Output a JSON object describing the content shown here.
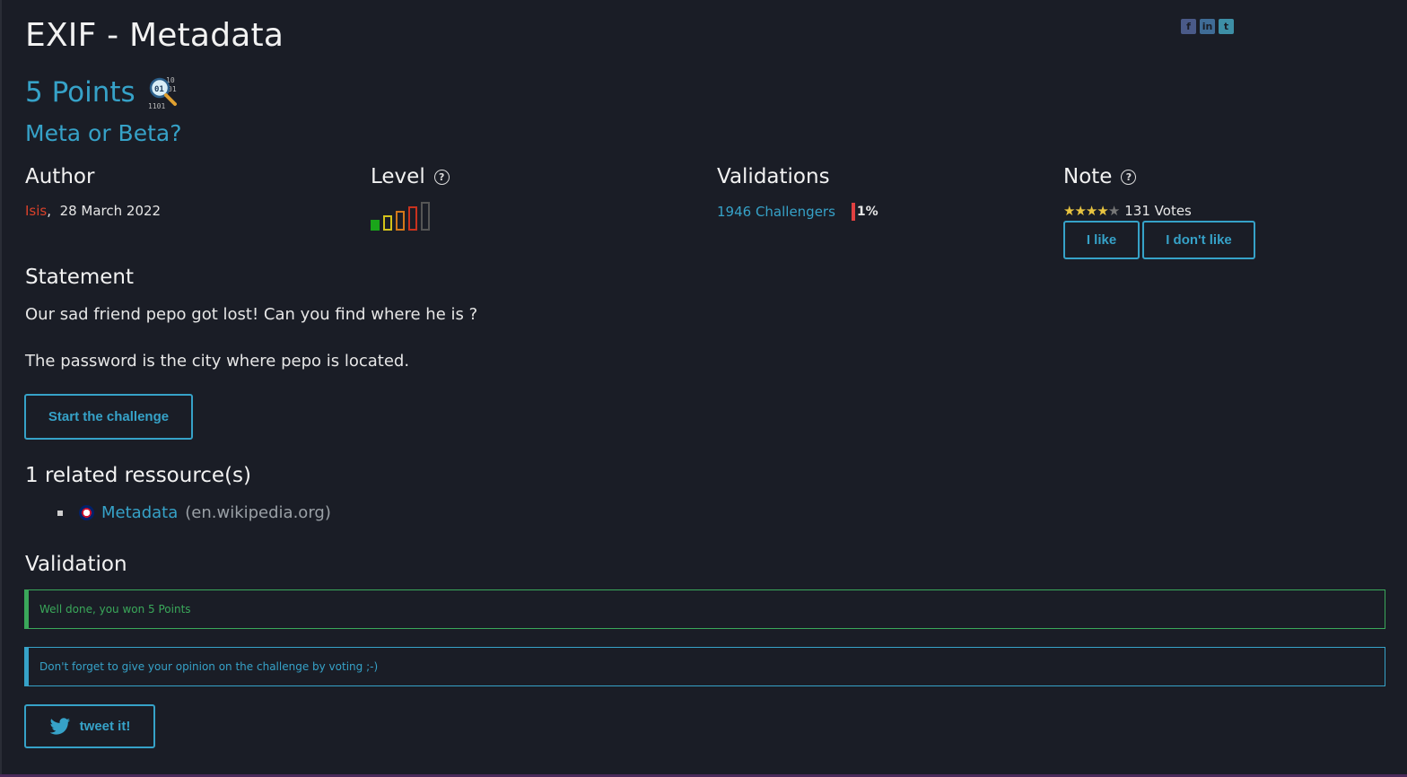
{
  "title": "EXIF - Metadata",
  "points": "5 Points",
  "subtitle": "Meta or Beta?",
  "share": {
    "facebook": "f",
    "linkedin": "in",
    "twitter": "t"
  },
  "author_col": {
    "heading": "Author",
    "name": "Isis",
    "sep": ",",
    "date": "28 March 2022"
  },
  "level_col": {
    "heading": "Level",
    "help": "?",
    "level": 1,
    "max": 5
  },
  "validations_col": {
    "heading": "Validations",
    "challengers": "1946 Challengers",
    "percent": "1%"
  },
  "note_col": {
    "heading": "Note",
    "help": "?",
    "rating": 4,
    "max": 5,
    "votes": "131 Votes",
    "like_label": "I like",
    "dislike_label": "I don't like"
  },
  "statement": {
    "heading": "Statement",
    "line1": "Our sad friend pepo got lost! Can you find where he is ?",
    "line2": "The password is the city where pepo is located.",
    "start_label": "Start the challenge"
  },
  "resources": {
    "heading": "1 related ressource(s)",
    "items": [
      {
        "title": "Metadata",
        "domain": "(en.wikipedia.org)"
      }
    ]
  },
  "validation": {
    "heading": "Validation",
    "success": "Well done, you won 5 Points",
    "info": "Don't forget to give your opinion on the challenge by voting ;-)",
    "tweet_label": "tweet it!"
  },
  "colors": {
    "accent": "#36a2c8",
    "success": "#3aa85a",
    "author": "#d9412a",
    "background": "#1a1d26"
  }
}
